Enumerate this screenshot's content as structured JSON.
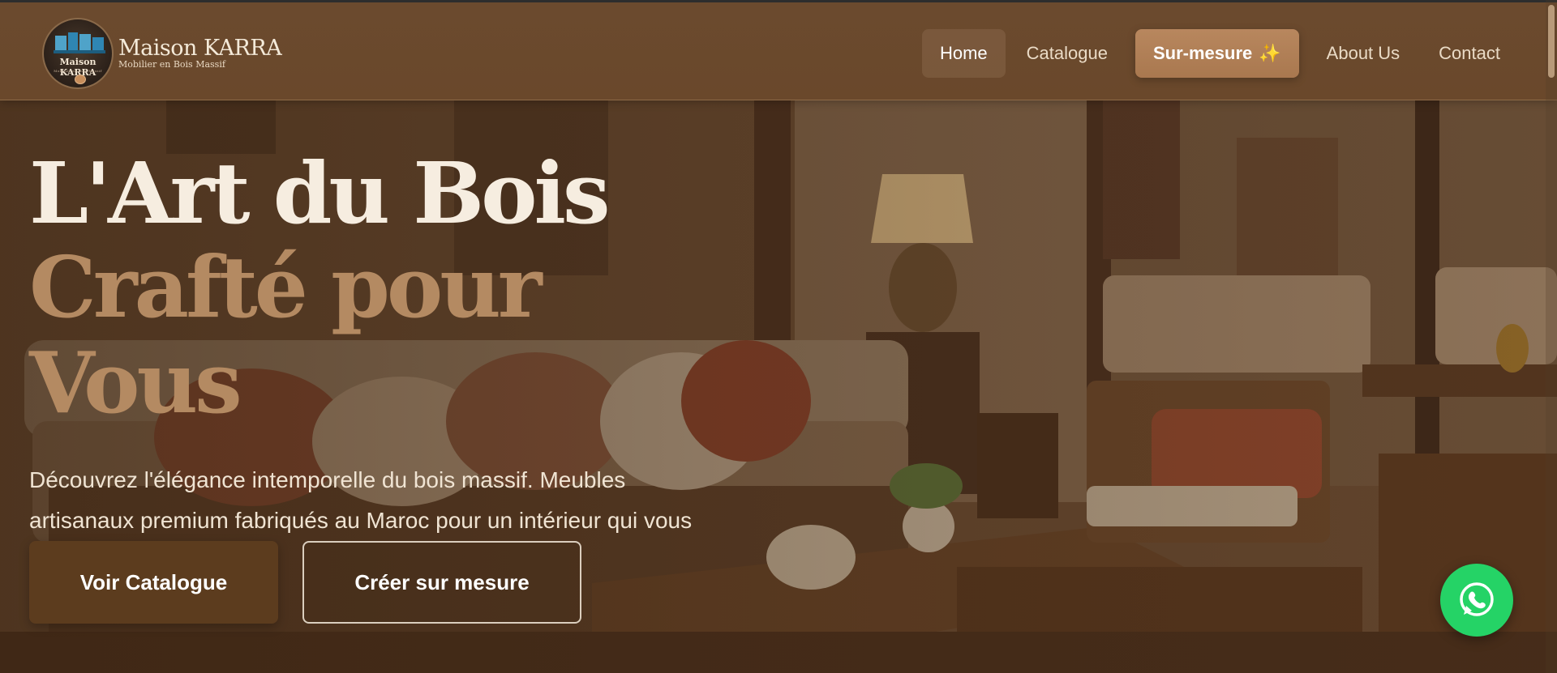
{
  "brand": {
    "logo_name": "Maison KARRA",
    "logo_sub": "Mobilier en Bois Massif",
    "title": "Maison KARRA",
    "tagline": "Mobilier en Bois Massif"
  },
  "nav": {
    "items": [
      {
        "label": "Home",
        "state": "active"
      },
      {
        "label": "Catalogue",
        "state": "default"
      },
      {
        "label": "Sur-mesure",
        "state": "highlight",
        "emoji": "✨"
      },
      {
        "label": "About Us",
        "state": "default"
      },
      {
        "label": "Contact",
        "state": "default"
      }
    ]
  },
  "hero": {
    "headline_line1": "L'Art du Bois",
    "headline_line2": "Crafté pour Vous",
    "description": "Découvrez l'élégance intemporelle du bois massif. Meubles artisanaux premium fabriqués au Maroc pour un intérieur qui vous ressemble.",
    "primary_cta": "Voir Catalogue",
    "secondary_cta": "Créer sur mesure"
  },
  "floating": {
    "whatsapp_icon": "whatsapp-icon"
  },
  "colors": {
    "nav_bg": "#6b4a2e",
    "accent": "#b48a62",
    "primary_button": "#5c3c1e",
    "whatsapp": "#25d366"
  }
}
